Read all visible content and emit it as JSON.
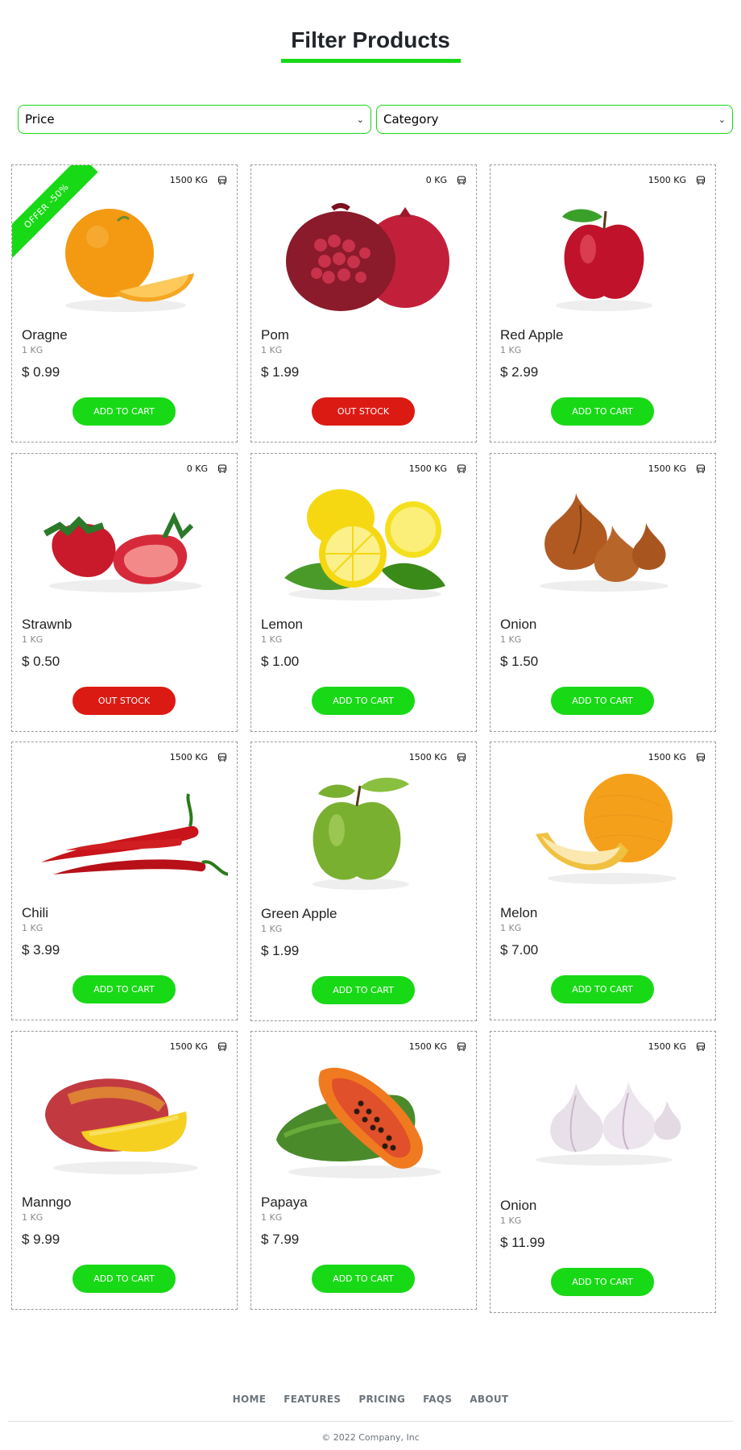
{
  "header": {
    "title": "Filter Products"
  },
  "filters": {
    "price": "Price",
    "category": "Category"
  },
  "products": [
    {
      "name": "Oragne",
      "weight": "1 KG",
      "price": "$ 0.99",
      "stock": "1500 KG",
      "button": "ADD TO CART",
      "status": "in",
      "offer": "OFFER -50%",
      "fruit": "orange"
    },
    {
      "name": "Pom",
      "weight": "1 KG",
      "price": "$ 1.99",
      "stock": "0 KG",
      "button": "OUT STOCK",
      "status": "out",
      "fruit": "pomegranate"
    },
    {
      "name": "Red Apple",
      "weight": "1 KG",
      "price": "$ 2.99",
      "stock": "1500 KG",
      "button": "ADD TO CART",
      "status": "in",
      "fruit": "red-apple"
    },
    {
      "name": "Strawnb",
      "weight": "1 KG",
      "price": "$ 0.50",
      "stock": "0 KG",
      "button": "OUT STOCK",
      "status": "out",
      "fruit": "strawberry"
    },
    {
      "name": "Lemon",
      "weight": "1 KG",
      "price": "$ 1.00",
      "stock": "1500 KG",
      "button": "ADD TO CART",
      "status": "in",
      "fruit": "lemon"
    },
    {
      "name": "Onion",
      "weight": "1 KG",
      "price": "$ 1.50",
      "stock": "1500 KG",
      "button": "ADD TO CART",
      "status": "in",
      "fruit": "onion"
    },
    {
      "name": "Chili",
      "weight": "1 KG",
      "price": "$ 3.99",
      "stock": "1500 KG",
      "button": "ADD TO CART",
      "status": "in",
      "fruit": "chili"
    },
    {
      "name": "Green Apple",
      "weight": "1 KG",
      "price": "$ 1.99",
      "stock": "1500 KG",
      "button": "ADD TO CART",
      "status": "in",
      "fruit": "green-apple"
    },
    {
      "name": "Melon",
      "weight": "1 KG",
      "price": "$ 7.00",
      "stock": "1500 KG",
      "button": "ADD TO CART",
      "status": "in",
      "fruit": "melon"
    },
    {
      "name": "Manngo",
      "weight": "1 KG",
      "price": "$ 9.99",
      "stock": "1500 KG",
      "button": "ADD TO CART",
      "status": "in",
      "fruit": "mango"
    },
    {
      "name": "Papaya",
      "weight": "1 KG",
      "price": "$ 7.99",
      "stock": "1500 KG",
      "button": "ADD TO CART",
      "status": "in",
      "fruit": "papaya"
    },
    {
      "name": "Onion",
      "weight": "1 KG",
      "price": "$ 11.99",
      "stock": "1500 KG",
      "button": "ADD TO CART",
      "status": "in",
      "fruit": "garlic"
    }
  ],
  "footer": {
    "nav": [
      "HOME",
      "FEATURES",
      "PRICING",
      "FAQS",
      "ABOUT"
    ],
    "copyright": "© 2022 Company, Inc"
  },
  "colors": {
    "accent": "#18d916",
    "out_of_stock": "#dc1a14"
  }
}
